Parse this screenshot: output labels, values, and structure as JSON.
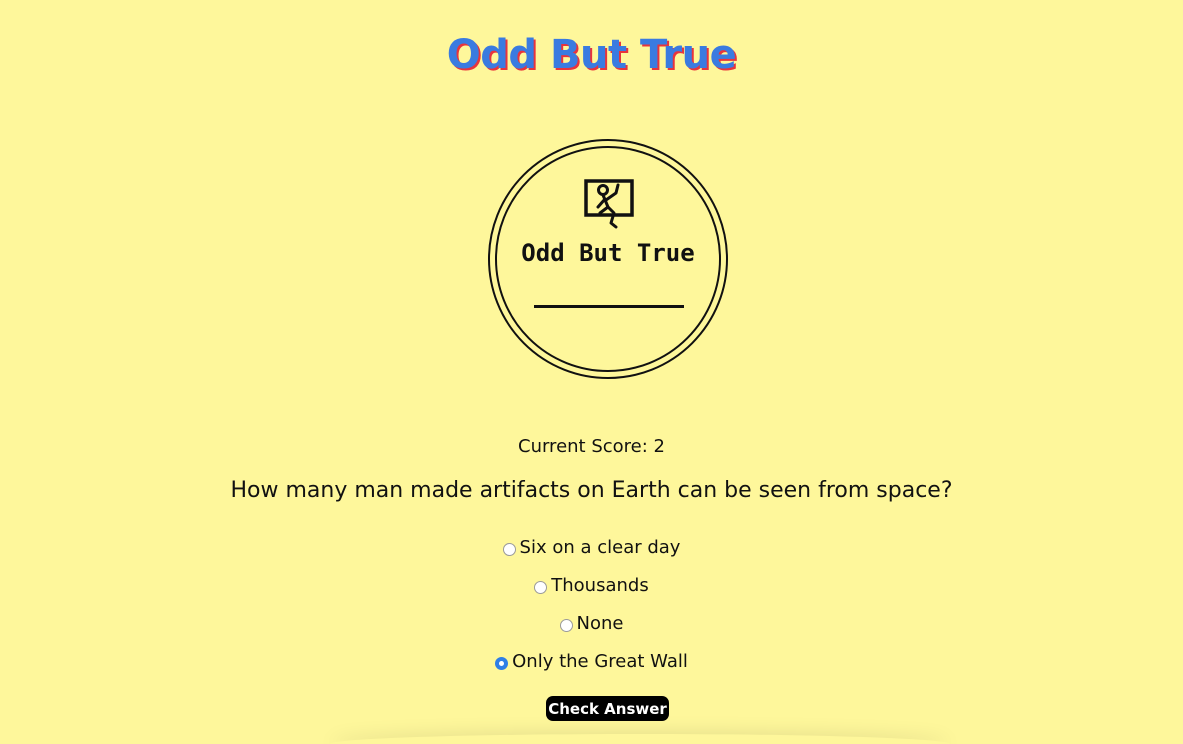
{
  "header": {
    "title": "Odd But True"
  },
  "logo": {
    "text": "Odd But True",
    "icon": "falling-figure-frame-icon"
  },
  "quiz": {
    "score_text": "Current Score: 2",
    "question": "How many man made artifacts on Earth can be seen from space?",
    "options": [
      {
        "label": "Six on a clear day",
        "selected": false
      },
      {
        "label": "Thousands",
        "selected": false
      },
      {
        "label": "None",
        "selected": false
      },
      {
        "label": "Only the Great Wall",
        "selected": true
      }
    ],
    "check_label": "Check Answer"
  },
  "colors": {
    "background": "#fef79b",
    "title_blue": "#3a7be0",
    "title_red_shadow": "#e8343c",
    "radio_selected": "#2f7fe6",
    "button_bg": "#000000"
  }
}
